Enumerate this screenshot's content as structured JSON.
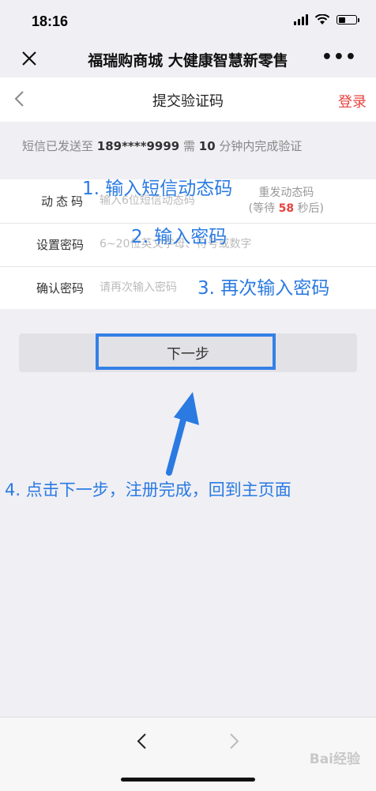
{
  "status_bar": {
    "time": "18:16"
  },
  "wechat_nav": {
    "title": "福瑞购商城 大健康智慧新零售",
    "more": "•••"
  },
  "page_header": {
    "title": "提交验证码",
    "login": "登录"
  },
  "notice": {
    "prefix": "短信已发送至 ",
    "phone": "189****9999",
    "mid": " 需 ",
    "minutes": "10",
    "suffix": " 分钟内完成验证"
  },
  "form": {
    "code_label": "动态码",
    "code_placeholder": "输入6位短信动态码",
    "resend_line1": "重发动态码",
    "resend_prefix": "(等待 ",
    "resend_seconds": "58",
    "resend_suffix": " 秒后)",
    "password_label": "设置密码",
    "password_placeholder": "6~20位英文字母、符号或数字",
    "confirm_label": "确认密码",
    "confirm_placeholder": "请再次输入密码"
  },
  "annotations": {
    "step1": "1. 输入短信动态码",
    "step2": "2. 输入密码",
    "step3": "3. 再次输入密码",
    "step4": "4. 点击下一步，注册完成，回到主页面"
  },
  "next_button": {
    "label": "下一步"
  },
  "watermark": "Bai经验",
  "colors": {
    "accent_red": "#e64340",
    "annotation_blue": "#2a7ae2",
    "highlight_box": "#3380e6"
  }
}
